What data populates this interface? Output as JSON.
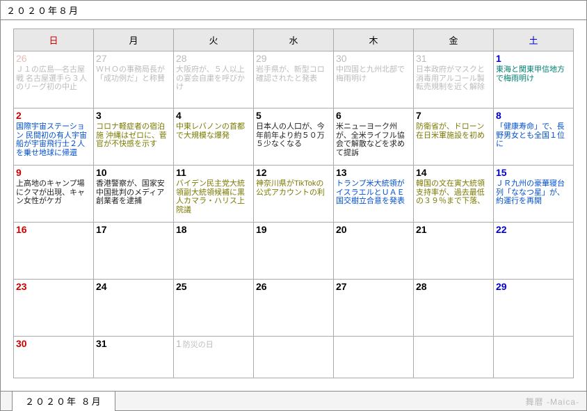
{
  "title": "２０２０年８月",
  "dow": [
    "日",
    "月",
    "火",
    "水",
    "木",
    "金",
    "土"
  ],
  "weeks": [
    [
      {
        "n": "26",
        "cls": "other-month sun",
        "note": "",
        "ev": [
          {
            "t": "Ｊ１の広島―名古屋戦 名古屋選手ら３人のリーグ初の中止",
            "c": "c-gray"
          }
        ]
      },
      {
        "n": "27",
        "cls": "other-month",
        "note": "",
        "ev": [
          {
            "t": "ＷＨＯの事務局長が「成功例だ」と称賛",
            "c": "c-gray"
          }
        ]
      },
      {
        "n": "28",
        "cls": "other-month",
        "note": "",
        "ev": [
          {
            "t": "大阪府が、５人以上の宴会自粛を呼びかけ",
            "c": "c-gray"
          }
        ]
      },
      {
        "n": "29",
        "cls": "other-month",
        "note": "",
        "ev": [
          {
            "t": "岩手県が、新型コロ確認されたと発表",
            "c": "c-gray"
          }
        ]
      },
      {
        "n": "30",
        "cls": "other-month",
        "note": "",
        "ev": [
          {
            "t": "中四国と九州北部で梅雨明け",
            "c": "c-gray"
          }
        ]
      },
      {
        "n": "31",
        "cls": "other-month",
        "note": "",
        "ev": [
          {
            "t": "日本政府がマスクと消毒用アルコール製転売規制を近く解除",
            "c": "c-gray"
          }
        ]
      },
      {
        "n": "1",
        "cls": "sat",
        "note": "",
        "ev": [
          {
            "t": "東海と関東甲信地方で梅雨明け",
            "c": "c-teal"
          }
        ]
      }
    ],
    [
      {
        "n": "2",
        "cls": "sun",
        "note": "",
        "ev": [
          {
            "t": "国際宇宙ステーション 民間初の有人宇宙船が宇宙飛行士２人を乗せ地球に帰還",
            "c": "c-blue"
          }
        ]
      },
      {
        "n": "3",
        "cls": "",
        "note": "",
        "ev": [
          {
            "t": "コロナ軽症者の宿泊施 沖縄はゼロに、菅官が不快感を示す",
            "c": "c-olive"
          }
        ]
      },
      {
        "n": "4",
        "cls": "",
        "note": "",
        "ev": [
          {
            "t": "中東レバノンの首都で大規模な爆発",
            "c": "c-olive"
          }
        ]
      },
      {
        "n": "5",
        "cls": "",
        "note": "",
        "ev": [
          {
            "t": "日本人の人口が、今年前年より約５０万５少なくなる",
            "c": "c-black"
          }
        ]
      },
      {
        "n": "6",
        "cls": "",
        "note": "",
        "ev": [
          {
            "t": "米ニューヨーク州が、全米ライフル協会で解散などを求めて提訴",
            "c": "c-black"
          }
        ]
      },
      {
        "n": "7",
        "cls": "",
        "note": "",
        "ev": [
          {
            "t": "防衛省が、ドローン在日米軍施設を初め",
            "c": "c-olive"
          }
        ]
      },
      {
        "n": "8",
        "cls": "sat",
        "note": "",
        "ev": [
          {
            "t": "「健康寿命」で、長野男女とも全国１位に",
            "c": "c-blue"
          }
        ]
      }
    ],
    [
      {
        "n": "9",
        "cls": "sun",
        "note": "",
        "ev": [
          {
            "t": "上高地のキャンプ場にクマが出現、キャン女性がケガ",
            "c": "c-black"
          }
        ]
      },
      {
        "n": "10",
        "cls": "",
        "note": "",
        "ev": [
          {
            "t": "香港警察が、国家安 中国批判のメディア創業者を逮捕",
            "c": "c-black"
          }
        ]
      },
      {
        "n": "11",
        "cls": "",
        "note": "",
        "ev": [
          {
            "t": "バイデン民主党大統領副大統領候補に黒人カマラ・ハリス上院議",
            "c": "c-olive"
          }
        ]
      },
      {
        "n": "12",
        "cls": "",
        "note": "",
        "ev": [
          {
            "t": "神奈川県がTikTokの公式アカウントの利",
            "c": "c-olive"
          }
        ]
      },
      {
        "n": "13",
        "cls": "",
        "note": "",
        "ev": [
          {
            "t": "トランプ米大統領がイスラエルとＵＡＥ国交樹立合意を発表",
            "c": "c-blue"
          }
        ]
      },
      {
        "n": "14",
        "cls": "",
        "note": "",
        "ev": [
          {
            "t": "韓国の文在寅大統領支持率が、過去最低の３９％まで下落、",
            "c": "c-olive"
          }
        ]
      },
      {
        "n": "15",
        "cls": "sat",
        "note": "",
        "ev": [
          {
            "t": "ＪＲ九州の豪華寝台列「ななつ星」が、約運行を再開",
            "c": "c-blue"
          }
        ]
      }
    ],
    [
      {
        "n": "16",
        "cls": "sun",
        "note": "",
        "ev": []
      },
      {
        "n": "17",
        "cls": "",
        "note": "",
        "ev": []
      },
      {
        "n": "18",
        "cls": "",
        "note": "",
        "ev": []
      },
      {
        "n": "19",
        "cls": "",
        "note": "",
        "ev": []
      },
      {
        "n": "20",
        "cls": "",
        "note": "",
        "ev": []
      },
      {
        "n": "21",
        "cls": "",
        "note": "",
        "ev": []
      },
      {
        "n": "22",
        "cls": "sat",
        "note": "",
        "ev": []
      }
    ],
    [
      {
        "n": "23",
        "cls": "sun",
        "note": "",
        "ev": []
      },
      {
        "n": "24",
        "cls": "",
        "note": "",
        "ev": []
      },
      {
        "n": "25",
        "cls": "",
        "note": "",
        "ev": []
      },
      {
        "n": "26",
        "cls": "",
        "note": "",
        "ev": []
      },
      {
        "n": "27",
        "cls": "",
        "note": "",
        "ev": []
      },
      {
        "n": "28",
        "cls": "",
        "note": "",
        "ev": []
      },
      {
        "n": "29",
        "cls": "sat",
        "note": "",
        "ev": []
      }
    ],
    [
      {
        "n": "30",
        "cls": "sun",
        "note": "",
        "ev": []
      },
      {
        "n": "31",
        "cls": "",
        "note": "",
        "ev": []
      },
      {
        "n": "1",
        "cls": "other-month",
        "note": "防災の日",
        "ev": []
      },
      {
        "n": "",
        "cls": "other-month",
        "note": "",
        "ev": []
      },
      {
        "n": "",
        "cls": "other-month",
        "note": "",
        "ev": []
      },
      {
        "n": "",
        "cls": "other-month",
        "note": "",
        "ev": []
      },
      {
        "n": "",
        "cls": "other-month",
        "note": "",
        "ev": []
      }
    ]
  ],
  "tab_label": "２０２０年 ８月",
  "brand": "舞暦 -Maica-"
}
